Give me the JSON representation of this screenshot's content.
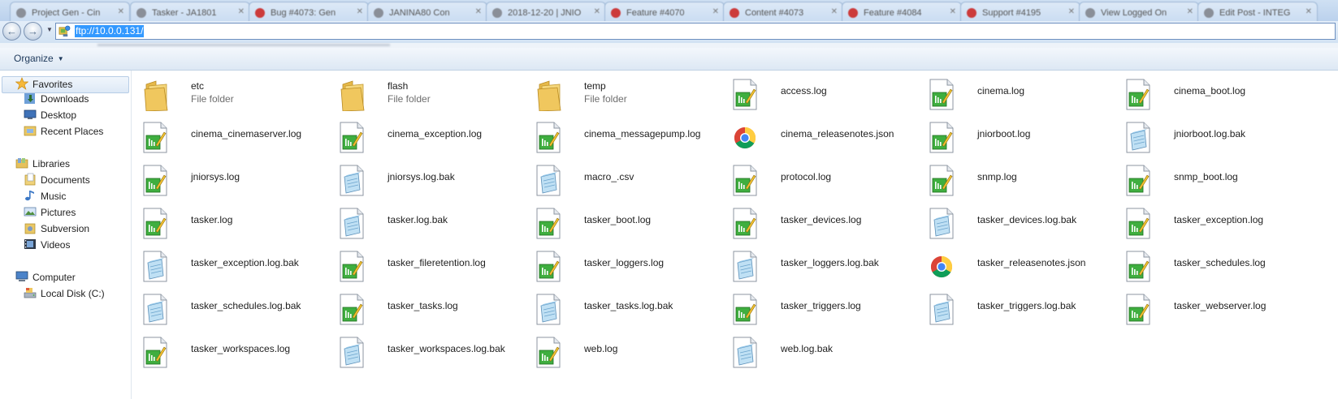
{
  "address": {
    "url": "ftp://10.0.0.131/"
  },
  "browser_tabs": [
    {
      "label": "Project Gen - Cin",
      "fav": "gray"
    },
    {
      "label": "Tasker - JA1801",
      "fav": "gray"
    },
    {
      "label": "Bug #4073: Gen",
      "fav": "red"
    },
    {
      "label": "JANINA80 Con",
      "fav": "gray"
    },
    {
      "label": "2018-12-20 | JNIO",
      "fav": "gray"
    },
    {
      "label": "Feature #4070",
      "fav": "red"
    },
    {
      "label": "Content #4073",
      "fav": "red"
    },
    {
      "label": "Feature #4084",
      "fav": "red"
    },
    {
      "label": "Support #4195",
      "fav": "red"
    },
    {
      "label": "View Logged On",
      "fav": "gray"
    },
    {
      "label": "Edit Post - INTEG",
      "fav": "gray"
    }
  ],
  "toolbar": {
    "organize_label": "Organize"
  },
  "nav": {
    "favorites": "Favorites",
    "downloads": "Downloads",
    "desktop": "Desktop",
    "recent": "Recent Places",
    "libraries": "Libraries",
    "documents": "Documents",
    "music": "Music",
    "pictures": "Pictures",
    "subversion": "Subversion",
    "videos": "Videos",
    "computer": "Computer",
    "local_disk": "Local Disk (C:)"
  },
  "files": [
    {
      "name": "etc",
      "type": "folder",
      "sub": "File folder"
    },
    {
      "name": "flash",
      "type": "folder",
      "sub": "File folder"
    },
    {
      "name": "temp",
      "type": "folder",
      "sub": "File folder"
    },
    {
      "name": "access.log",
      "type": "log"
    },
    {
      "name": "cinema.log",
      "type": "log"
    },
    {
      "name": "cinema_boot.log",
      "type": "log"
    },
    {
      "name": "cinema_cinemaserver.log",
      "type": "log"
    },
    {
      "name": "cinema_exception.log",
      "type": "log"
    },
    {
      "name": "cinema_messagepump.log",
      "type": "log"
    },
    {
      "name": "cinema_releasenotes.json",
      "type": "chrome"
    },
    {
      "name": "jniorboot.log",
      "type": "log"
    },
    {
      "name": "jniorboot.log.bak",
      "type": "bak"
    },
    {
      "name": "jniorsys.log",
      "type": "log"
    },
    {
      "name": "jniorsys.log.bak",
      "type": "bak"
    },
    {
      "name": "macro_.csv",
      "type": "bak"
    },
    {
      "name": "protocol.log",
      "type": "log"
    },
    {
      "name": "snmp.log",
      "type": "log"
    },
    {
      "name": "snmp_boot.log",
      "type": "log"
    },
    {
      "name": "tasker.log",
      "type": "log"
    },
    {
      "name": "tasker.log.bak",
      "type": "bak"
    },
    {
      "name": "tasker_boot.log",
      "type": "log"
    },
    {
      "name": "tasker_devices.log",
      "type": "log"
    },
    {
      "name": "tasker_devices.log.bak",
      "type": "bak"
    },
    {
      "name": "tasker_exception.log",
      "type": "log"
    },
    {
      "name": "tasker_exception.log.bak",
      "type": "bak"
    },
    {
      "name": "tasker_fileretention.log",
      "type": "log"
    },
    {
      "name": "tasker_loggers.log",
      "type": "log"
    },
    {
      "name": "tasker_loggers.log.bak",
      "type": "bak"
    },
    {
      "name": "tasker_releasenotes.json",
      "type": "chrome"
    },
    {
      "name": "tasker_schedules.log",
      "type": "log"
    },
    {
      "name": "tasker_schedules.log.bak",
      "type": "bak"
    },
    {
      "name": "tasker_tasks.log",
      "type": "log"
    },
    {
      "name": "tasker_tasks.log.bak",
      "type": "bak"
    },
    {
      "name": "tasker_triggers.log",
      "type": "log"
    },
    {
      "name": "tasker_triggers.log.bak",
      "type": "bak"
    },
    {
      "name": "tasker_webserver.log",
      "type": "log"
    },
    {
      "name": "tasker_workspaces.log",
      "type": "log"
    },
    {
      "name": "tasker_workspaces.log.bak",
      "type": "bak"
    },
    {
      "name": "web.log",
      "type": "log"
    },
    {
      "name": "web.log.bak",
      "type": "bak"
    }
  ],
  "icons": {
    "folder": "folder-icon",
    "log": "log-file-icon",
    "bak": "notepad-file-icon",
    "chrome": "chrome-json-icon"
  },
  "colors": {
    "selection": "#3399ff",
    "folder": "#f0c75e",
    "log_green": "#3fae3f",
    "nav_selected": "#dde9f6"
  }
}
